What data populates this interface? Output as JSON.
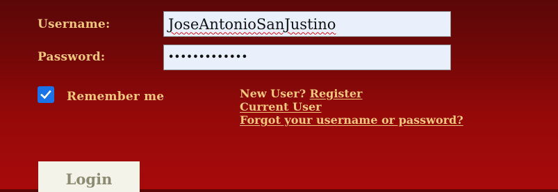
{
  "form": {
    "username_label": "Username:",
    "username_value": "JoseAntonioSanJustino",
    "password_label": "Password:",
    "password_value": "•••••••••••••",
    "remember_label": "Remember me",
    "remember_checked": true,
    "new_user_text": "New User?",
    "register_link": "Register",
    "current_user_link": "Current User",
    "forgot_link": "Forgot your username or password?",
    "login_button": "Login"
  },
  "colors": {
    "label_gold": "#f0c77c",
    "background_red": "#950909",
    "checkbox_blue": "#1a73e8",
    "field_bg": "#e9f0fc"
  },
  "icons": {
    "checkbox": "checkmark-icon"
  }
}
